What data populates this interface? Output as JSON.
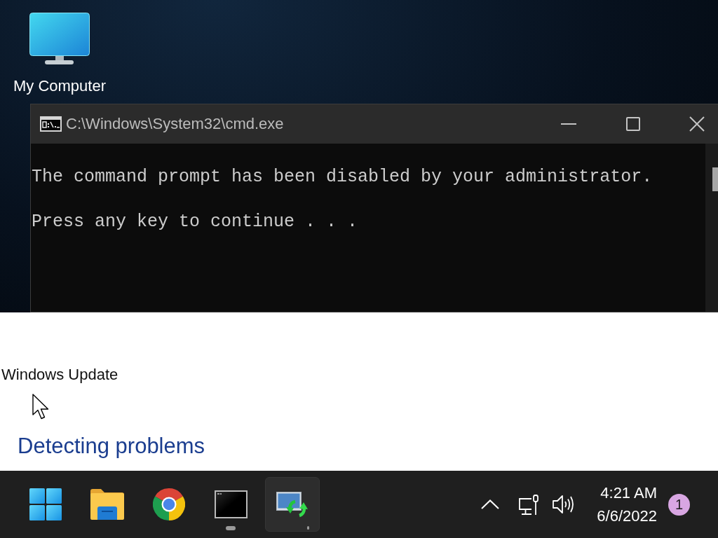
{
  "desktop": {
    "icons": [
      {
        "label": "My Computer"
      }
    ]
  },
  "console_window": {
    "title": "C:\\Windows\\System32\\cmd.exe",
    "lines": [
      "The command prompt has been disabled by your administrator.",
      "Press any key to continue . . ."
    ]
  },
  "update_window": {
    "title": "Windows Update",
    "status": "Detecting problems"
  },
  "taskbar": {
    "apps": [
      {
        "kind": "start",
        "running": false,
        "selected": false
      },
      {
        "kind": "folder",
        "running": false,
        "selected": false
      },
      {
        "kind": "browser",
        "running": false,
        "selected": false
      },
      {
        "kind": "console",
        "running": true,
        "selected": false
      },
      {
        "kind": "update",
        "running": true,
        "selected": true
      }
    ],
    "tray": {
      "time": "4:21 AM",
      "date": "6/6/2022",
      "notification_count": "1"
    }
  }
}
